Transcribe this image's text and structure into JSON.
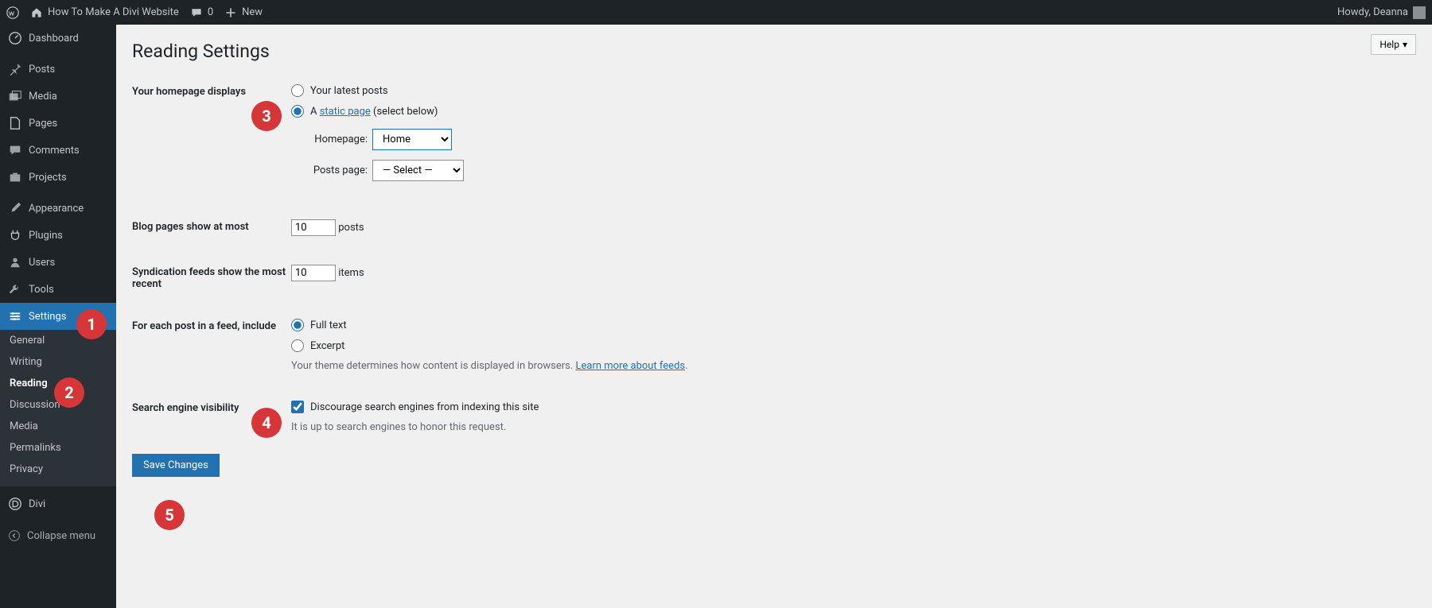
{
  "adminbar": {
    "site": "How To Make A Divi Website",
    "comments": "0",
    "new": "New",
    "howdy": "Howdy, Deanna"
  },
  "sidebar": {
    "dashboard": "Dashboard",
    "posts": "Posts",
    "media": "Media",
    "pages": "Pages",
    "comments": "Comments",
    "projects": "Projects",
    "appearance": "Appearance",
    "plugins": "Plugins",
    "users": "Users",
    "tools": "Tools",
    "settings": "Settings",
    "submenu": {
      "general": "General",
      "writing": "Writing",
      "reading": "Reading",
      "discussion": "Discussion",
      "mediaItem": "Media",
      "permalinks": "Permalinks",
      "privacy": "Privacy"
    },
    "divi": "Divi",
    "collapse": "Collapse menu"
  },
  "page": {
    "help": "Help",
    "title": "Reading Settings"
  },
  "form": {
    "homepageLabel": "Your homepage displays",
    "latest": "Your latest posts",
    "staticA": "A ",
    "staticLink": "static page",
    "staticSuffix": " (select below)",
    "homepageSelectLabel": "Homepage:",
    "homepageValue": "Home",
    "postsPageLabel": "Posts page:",
    "postsPageValue": "— Select —",
    "blogPagesLabel": "Blog pages show at most",
    "blogPagesValue": "10",
    "postsWord": "posts",
    "syndLabel": "Syndication feeds show the most recent",
    "syndValue": "10",
    "itemsWord": "items",
    "feedLabel": "For each post in a feed, include",
    "fullText": "Full text",
    "excerpt": "Excerpt",
    "feedDesc1": "Your theme determines how content is displayed in browsers. ",
    "feedLink": "Learn more about feeds",
    "seoLabel": "Search engine visibility",
    "seoCheck": "Discourage search engines from indexing this site",
    "seoDesc": "It is up to search engines to honor this request.",
    "save": "Save Changes"
  },
  "badges": {
    "b1": "1",
    "b2": "2",
    "b3": "3",
    "b4": "4",
    "b5": "5"
  }
}
